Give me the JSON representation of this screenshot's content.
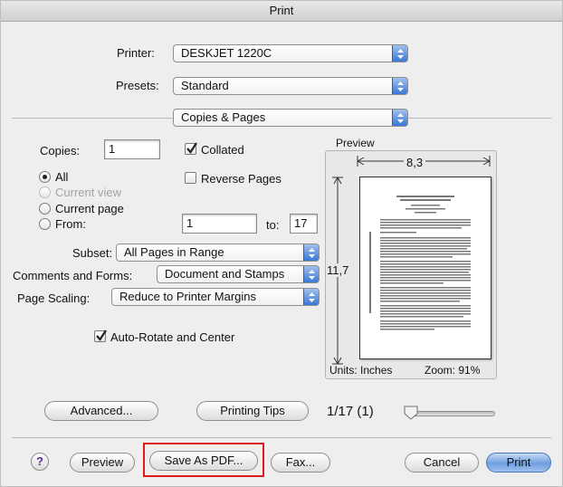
{
  "window": {
    "title": "Print"
  },
  "printer": {
    "label": "Printer:",
    "value": "DESKJET 1220C"
  },
  "presets": {
    "label": "Presets:",
    "value": "Standard"
  },
  "panel": {
    "value": "Copies & Pages"
  },
  "copies": {
    "label": "Copies:",
    "value": "1",
    "collated_label": "Collated",
    "reverse_label": "Reverse Pages"
  },
  "pages": {
    "all_label": "All",
    "current_view_label": "Current view",
    "current_page_label": "Current page",
    "from_label": "From:",
    "from_value": "1",
    "to_label": "to:",
    "to_value": "17"
  },
  "subset": {
    "label": "Subset:",
    "value": "All Pages in Range"
  },
  "comments": {
    "label": "Comments and Forms:",
    "value": "Document and Stamps"
  },
  "scaling": {
    "label": "Page Scaling:",
    "value": "Reduce to Printer Margins"
  },
  "autorotate": {
    "label": "Auto-Rotate and Center"
  },
  "preview": {
    "title": "Preview",
    "width_label": "8,3",
    "height_label": "11,7",
    "units_label": "Units: Inches",
    "zoom_label": "Zoom:  91%"
  },
  "buttons": {
    "advanced": "Advanced...",
    "printing_tips": "Printing Tips",
    "help": "?",
    "preview": "Preview",
    "save_pdf": "Save As PDF...",
    "fax": "Fax...",
    "cancel": "Cancel",
    "print": "Print"
  },
  "page_indicator": "1/17 (1)",
  "colors": {
    "highlight": "#e0191b",
    "accent": "#3a78d8"
  }
}
